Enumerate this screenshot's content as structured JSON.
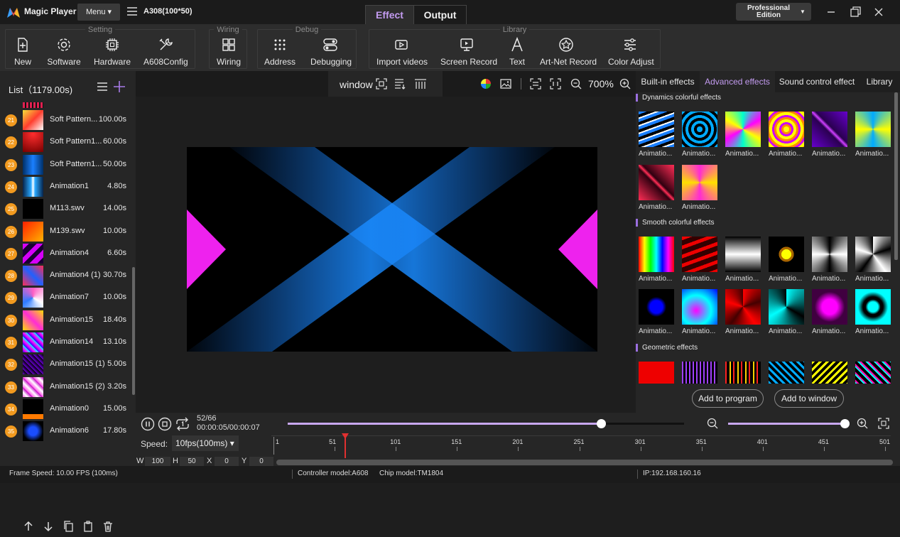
{
  "app": {
    "name": "Magic Player",
    "menu_label": "Menu",
    "document_title": "A308(100*50)"
  },
  "mode_tabs": [
    {
      "label": "Effect",
      "active": true
    },
    {
      "label": "Output",
      "active": false
    }
  ],
  "edition": {
    "label_line1": "Professional",
    "label_line2": "Edition"
  },
  "toolbar": {
    "groups": [
      {
        "title": "Setting",
        "items": [
          "New",
          "Software",
          "Hardware",
          "A608Config"
        ]
      },
      {
        "title": "Wiring",
        "items": [
          "Wiring"
        ]
      },
      {
        "title": "Debug",
        "items": [
          "Address",
          "Debugging"
        ]
      },
      {
        "title": "Library",
        "items": [
          "Import videos",
          "Screen Record",
          "Text",
          "Art-Net Record",
          "Color Adjust"
        ]
      }
    ]
  },
  "list": {
    "header": "List（1179.00s)",
    "items": [
      {
        "num": "21",
        "name": "Soft Pattern...",
        "duration": "100.00s"
      },
      {
        "num": "22",
        "name": "Soft Pattern1...",
        "duration": "60.00s"
      },
      {
        "num": "23",
        "name": "Soft Pattern1...",
        "duration": "50.00s"
      },
      {
        "num": "24",
        "name": "Animation1",
        "duration": "4.80s"
      },
      {
        "num": "25",
        "name": "M113.swv",
        "duration": "14.00s"
      },
      {
        "num": "26",
        "name": "M139.swv",
        "duration": "10.00s"
      },
      {
        "num": "27",
        "name": "Animation4",
        "duration": "6.60s"
      },
      {
        "num": "28",
        "name": "Animation4 (1)",
        "duration": "30.70s"
      },
      {
        "num": "29",
        "name": "Animation7",
        "duration": "10.00s"
      },
      {
        "num": "30",
        "name": "Animation15",
        "duration": "18.40s"
      },
      {
        "num": "31",
        "name": "Animation14",
        "duration": "13.10s"
      },
      {
        "num": "32",
        "name": "Animation15 (1)",
        "duration": "5.00s"
      },
      {
        "num": "33",
        "name": "Animation15 (2)",
        "duration": "3.20s"
      },
      {
        "num": "34",
        "name": "Animation0",
        "duration": "15.00s"
      },
      {
        "num": "35",
        "name": "Animation6",
        "duration": "17.80s"
      }
    ]
  },
  "preview": {
    "window_label": "window",
    "zoom": "700%"
  },
  "effects": {
    "tabs": [
      "Built-in effects",
      "Advanced effects",
      "Sound control effect",
      "Library"
    ],
    "active_tab": "Advanced effects",
    "sections": [
      {
        "title": "Dynamics colorful effects",
        "items": [
          "Animatio...",
          "Animatio...",
          "Animatio...",
          "Animatio...",
          "Animatio...",
          "Animatio...",
          "Animatio...",
          "Animatio..."
        ]
      },
      {
        "title": "Smooth colorful effects",
        "items": [
          "Animatio...",
          "Animatio...",
          "Animatio...",
          "Animatio...",
          "Animatio...",
          "Animatio...",
          "Animatio...",
          "Animatio...",
          "Animatio...",
          "Animatio...",
          "Animatio...",
          "Animatio..."
        ]
      },
      {
        "title": "Geometric effects",
        "items": []
      }
    ],
    "add_to_program": "Add to program",
    "add_to_window": "Add to window"
  },
  "playback": {
    "frame": "52/66",
    "time": "00:00:05/00:00:07",
    "progress": 0.79,
    "speed_label": "Speed:",
    "speed_value": "10fps(100ms)",
    "ruler": [
      "1",
      "51",
      "101",
      "151",
      "201",
      "251",
      "301",
      "351",
      "401",
      "451",
      "501"
    ],
    "w_label": "W",
    "w_value": "100",
    "h_label": "H",
    "h_value": "50",
    "x_label": "X",
    "x_value": "0",
    "y_label": "Y",
    "y_value": "0"
  },
  "status": {
    "frame_speed": "Frame Speed: 10.00 FPS (100ms)",
    "controller": "Controller model:A608",
    "chip": "Chip model:TM1804",
    "ip": "IP:192.168.160.16"
  },
  "colors": {
    "accent": "#c39bf0",
    "badge": "#f29a1f",
    "slider": "#c8a8f0"
  }
}
